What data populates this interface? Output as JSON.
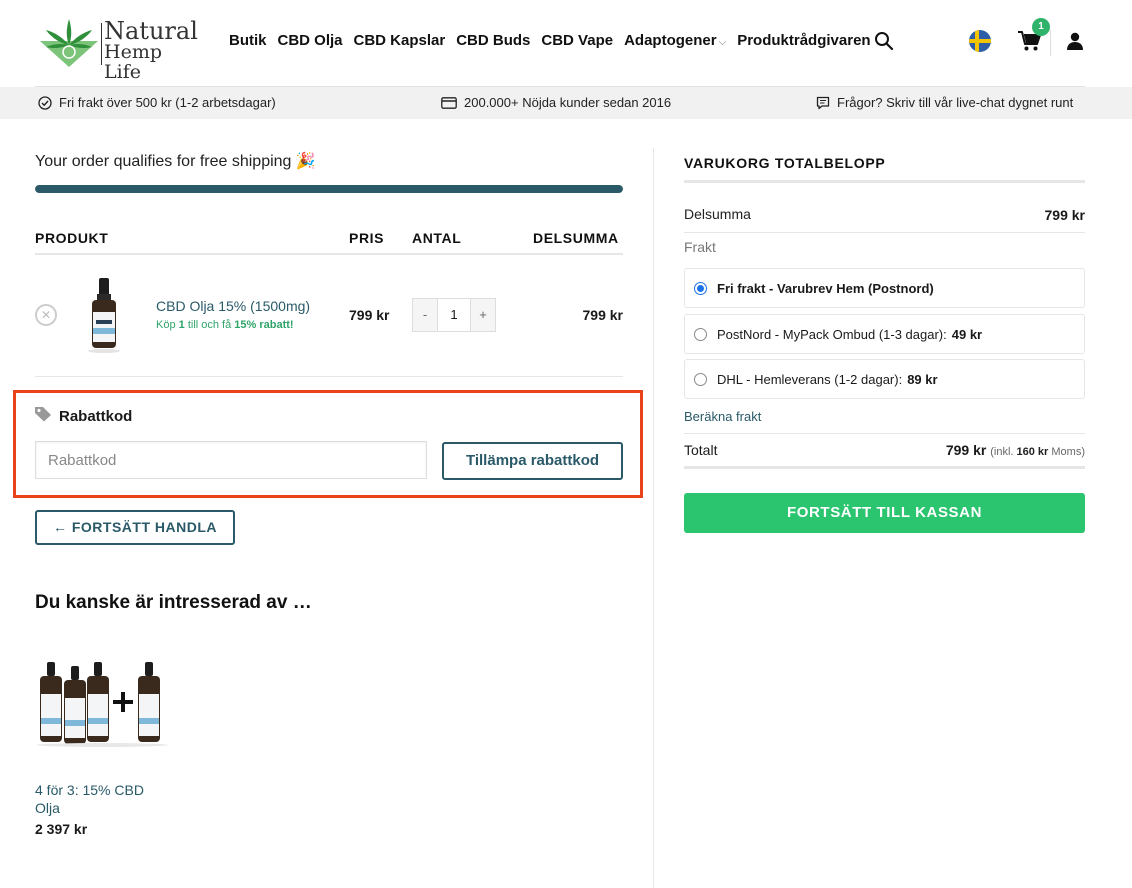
{
  "header": {
    "logo_line1": "Natural",
    "logo_line2": "Hemp Life",
    "nav": [
      "Butik",
      "CBD Olja",
      "CBD Kapslar",
      "CBD Buds",
      "CBD Vape",
      "Adaptogener",
      "Produktrådgivaren"
    ],
    "cart_count": "1"
  },
  "infobar": {
    "shipping": "Fri frakt över 500 kr (1-2 arbetsdagar)",
    "customers": "200.000+ Nöjda kunder sedan 2016",
    "support": "Frågor? Skriv till vår live-chat dygnet runt"
  },
  "cart": {
    "free_shipping_msg": "Your order qualifies for free shipping 🎉",
    "progress": 1.0,
    "headers": {
      "product": "PRODUKT",
      "price": "PRIS",
      "qty": "ANTAL",
      "subtotal": "DELSUMMA"
    },
    "items": [
      {
        "name": "CBD Olja 15% (1500mg)",
        "promo_a": "Köp ",
        "promo_b": "1",
        "promo_c": " till och få ",
        "promo_d": "15% rabatt!",
        "price": "799 kr",
        "qty_minus": "-",
        "quantity": "1",
        "qty_plus": "+",
        "subtotal": "799 kr"
      }
    ],
    "coupon": {
      "title": "Rabattkod",
      "placeholder": "Rabattkod",
      "button": "Tillämpa rabattkod"
    },
    "continue": "← FORTSÄTT HANDLA"
  },
  "related": {
    "title": "Du kanske är intresserad av …",
    "product_name": "4 för 3: 15% CBD Olja",
    "product_price": "2 397 kr"
  },
  "totals": {
    "title": "VARUKORG TOTALBELOPP",
    "subtotal_label": "Delsumma",
    "subtotal_value": "799 kr",
    "shipping_label": "Frakt",
    "options": [
      {
        "label": "Fri frakt - Varubrev Hem (Postnord)",
        "price": "",
        "selected": true
      },
      {
        "label": "PostNord - MyPack Ombud (1-3 dagar):",
        "price": "49 kr",
        "selected": false
      },
      {
        "label": "DHL - Hemleverans (1-2 dagar):",
        "price": "89 kr",
        "selected": false
      }
    ],
    "calc_link": "Beräkna frakt",
    "total_label": "Totalt",
    "total_value": "799 kr",
    "tax_prefix": "(inkl.",
    "tax_amount": "160 kr",
    "tax_suffix": "Moms)",
    "checkout": "FORTSÄTT TILL KASSAN"
  },
  "colors": {
    "accent": "#2a5a68",
    "checkout": "#2bc46f",
    "highlight": "#e8431a",
    "promo": "#2fa46a"
  }
}
